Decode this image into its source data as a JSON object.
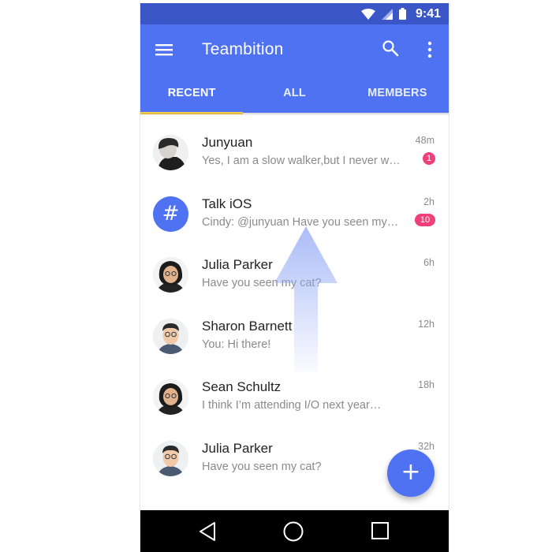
{
  "status_bar": {
    "time": "9:41"
  },
  "app_bar": {
    "title": "Teambition",
    "icons": {
      "menu": "hamburger-menu-icon",
      "search": "search-icon",
      "more": "more-vert-icon"
    },
    "background": "#4f72f2",
    "status_background": "#3b56c6"
  },
  "tabs": [
    {
      "label": "RECENT",
      "active": true
    },
    {
      "label": "ALL",
      "active": false
    },
    {
      "label": "MEMBERS",
      "active": false
    }
  ],
  "tab_indicator_color": "#ffd54a",
  "conversations": [
    {
      "name": "Junyuan",
      "preview": "Yes, I am a slow walker,but I never walk backwards",
      "time": "48m",
      "badge": "1"
    },
    {
      "name": "Talk iOS",
      "preview": "Cindy: @junyuan  Have you seen my cat?",
      "time": "2h",
      "badge": "10",
      "avatar_glyph": "#"
    },
    {
      "name": "Julia Parker",
      "preview": "Have you seen my cat?",
      "time": "6h"
    },
    {
      "name": "Sharon Barnett",
      "preview": "You: Hi there!",
      "time": "12h"
    },
    {
      "name": "Sean Schultz",
      "preview": "I think I’m attending I/O next year…",
      "time": "18h"
    },
    {
      "name": "Julia Parker",
      "preview": "Have you seen my cat?",
      "time": "32h"
    }
  ],
  "badge_color": "#f23f7a",
  "fab": {
    "glyph": "+",
    "icon": "add-icon"
  },
  "nav_bar": {
    "icons": [
      "back-triangle-icon",
      "home-circle-icon",
      "recents-square-icon"
    ]
  }
}
